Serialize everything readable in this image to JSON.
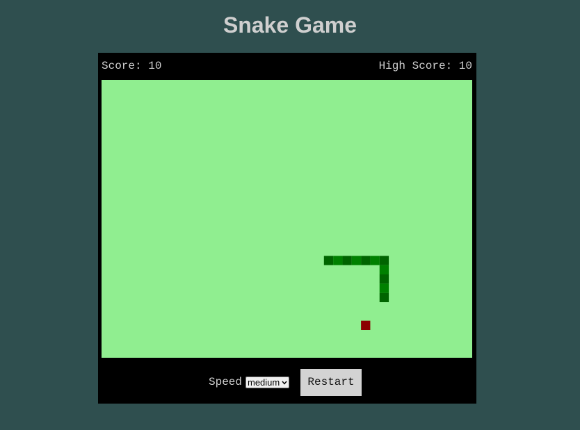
{
  "page": {
    "title": "Snake Game",
    "background": "#2f4f4f"
  },
  "scoreboard": {
    "score_text": "Score: 10",
    "high_score_text": "High Score: 10",
    "score": 10,
    "high_score": 10
  },
  "board": {
    "background": "#90ee90",
    "cell_units": "grid cells",
    "columns": 40,
    "rows": 30,
    "snake": {
      "colors": [
        "#006400",
        "#008000"
      ],
      "segments": [
        {
          "col": 30,
          "row": 23
        },
        {
          "col": 30,
          "row": 22
        },
        {
          "col": 30,
          "row": 21
        },
        {
          "col": 30,
          "row": 20
        },
        {
          "col": 30,
          "row": 19
        },
        {
          "col": 29,
          "row": 19
        },
        {
          "col": 28,
          "row": 19
        },
        {
          "col": 27,
          "row": 19
        },
        {
          "col": 26,
          "row": 19
        },
        {
          "col": 25,
          "row": 19
        },
        {
          "col": 24,
          "row": 19
        }
      ]
    },
    "food": {
      "col": 28,
      "row": 26,
      "color": "#8b0000"
    }
  },
  "controls": {
    "speed_label": "Speed",
    "speed_selected": "medium",
    "restart_label": "Restart"
  }
}
